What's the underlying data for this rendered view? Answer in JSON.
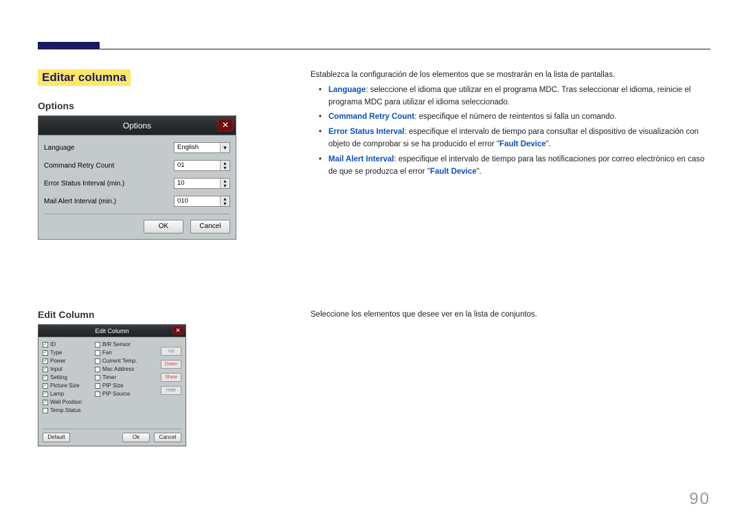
{
  "page_number": "90",
  "section_title": "Editar columna",
  "headings": {
    "options": "Options",
    "edit_column": "Edit Column"
  },
  "right_intro": "Establezca la configuración de los elementos que se mostrarán en la lista de pantallas.",
  "bullets": {
    "lang_label": "Language",
    "lang_text": ": seleccione el idioma que utilizar en el programa MDC. Tras seleccionar el idioma, reinicie el programa MDC para utilizar el idioma seleccionado.",
    "crc_label": "Command Retry Count",
    "crc_text": ": especifique el número de reintentos si falla un comando.",
    "esi_label": "Error Status Interval",
    "esi_text_a": ": especifique el intervalo de tiempo para consultar el dispositivo de visualización con objeto de comprobar si se ha producido el error \"",
    "esi_fault": "Fault Device",
    "esi_text_b": "\".",
    "mai_label": "Mail Alert Interval",
    "mai_text_a": ": especifique el intervalo de tiempo para las notificaciones por correo electrónico en caso de que se produzca el error \"",
    "mai_fault": "Fault Device",
    "mai_text_b": "\"."
  },
  "editcol_intro": "Seleccione los elementos que desee ver en la lista de conjuntos.",
  "options_dialog": {
    "title": "Options",
    "rows": {
      "language": {
        "label": "Language",
        "value": "English"
      },
      "crc": {
        "label": "Command Retry Count",
        "value": "01"
      },
      "esi": {
        "label": "Error Status Interval (min.)",
        "value": "10"
      },
      "mai": {
        "label": "Mail Alert Interval (min.)",
        "value": "010"
      }
    },
    "ok": "OK",
    "cancel": "Cancel"
  },
  "editcol_dialog": {
    "title": "Edit Column",
    "left_items": [
      {
        "label": "ID",
        "checked": true
      },
      {
        "label": "Type",
        "checked": true
      },
      {
        "label": "Power",
        "checked": true
      },
      {
        "label": "Input",
        "checked": true
      },
      {
        "label": "Setting",
        "checked": true
      },
      {
        "label": "Picture Size",
        "checked": true
      },
      {
        "label": "Lamp",
        "checked": true
      },
      {
        "label": "Wall Position",
        "checked": true
      },
      {
        "label": "Temp.Status",
        "checked": false
      }
    ],
    "right_items": [
      {
        "label": "B/R Sensor",
        "checked": false
      },
      {
        "label": "Fan",
        "checked": false
      },
      {
        "label": "Current Temp.",
        "checked": false
      },
      {
        "label": "Mac Address",
        "checked": false
      },
      {
        "label": "Timer",
        "checked": false
      },
      {
        "label": "PIP Size",
        "checked": false
      },
      {
        "label": "PIP Source",
        "checked": false
      }
    ],
    "side": {
      "up": "Up",
      "down": "Down",
      "show": "Show",
      "hide": "Hide"
    },
    "default": "Default",
    "ok": "Ok",
    "cancel": "Cancel"
  }
}
